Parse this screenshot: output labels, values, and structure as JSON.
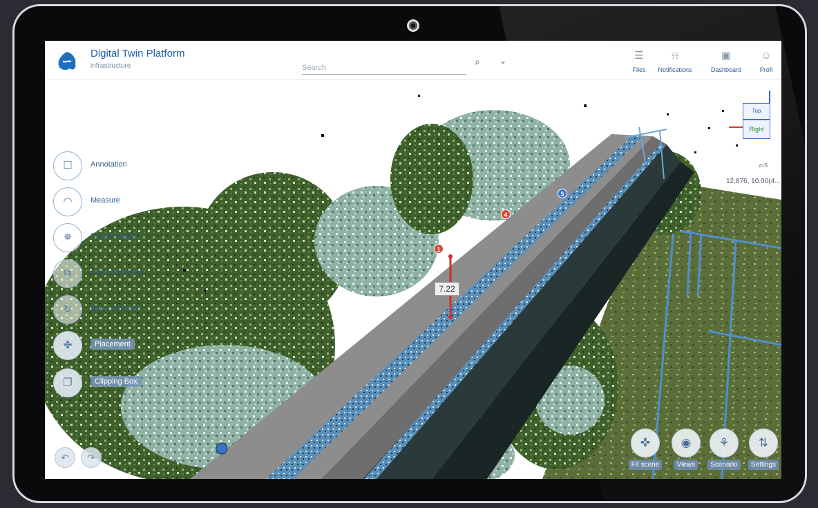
{
  "app": {
    "title": "Digital Twin Platform",
    "subtitle": "infrastructure"
  },
  "search": {
    "placeholder": "Search"
  },
  "nav": [
    {
      "label": "Files",
      "icon": "list-icon"
    },
    {
      "label": "Notifications",
      "icon": "bell-icon"
    },
    {
      "label": "Dashboard",
      "icon": "dashboard-icon"
    },
    {
      "label": "Profi",
      "icon": "user-icon"
    }
  ],
  "tools": [
    {
      "label": "Annotation",
      "icon": "comment-icon"
    },
    {
      "label": "Measure",
      "icon": "ruler-icon"
    },
    {
      "label": "Extract Region",
      "icon": "region-icon"
    },
    {
      "label": "Clash Detection",
      "icon": "clash-icon"
    },
    {
      "label": "Move & Rotate",
      "icon": "rotate-icon"
    },
    {
      "label": "Placement",
      "icon": "placement-icon"
    },
    {
      "label": "Clipping Box",
      "icon": "clip-box-icon"
    }
  ],
  "bottom_buttons": [
    {
      "label": "Fit scene",
      "icon": "fit-scene-icon"
    },
    {
      "label": "Views",
      "icon": "eye-icon"
    },
    {
      "label": "Scenario",
      "icon": "scenario-icon"
    },
    {
      "label": "Settings",
      "icon": "settings-icon"
    }
  ],
  "viewcube": {
    "top": "Top",
    "right": "Right"
  },
  "zoom_label": "z=5",
  "coords": "12,876, 10.00(4...",
  "measurement": {
    "value": "7.22"
  },
  "markers": [
    "1",
    "4",
    "5"
  ],
  "colors": {
    "accent": "#1f5fa8",
    "measure_line": "#d42a2a",
    "marker_red": "#d8453a",
    "marker_blue": "#3a72c8"
  }
}
